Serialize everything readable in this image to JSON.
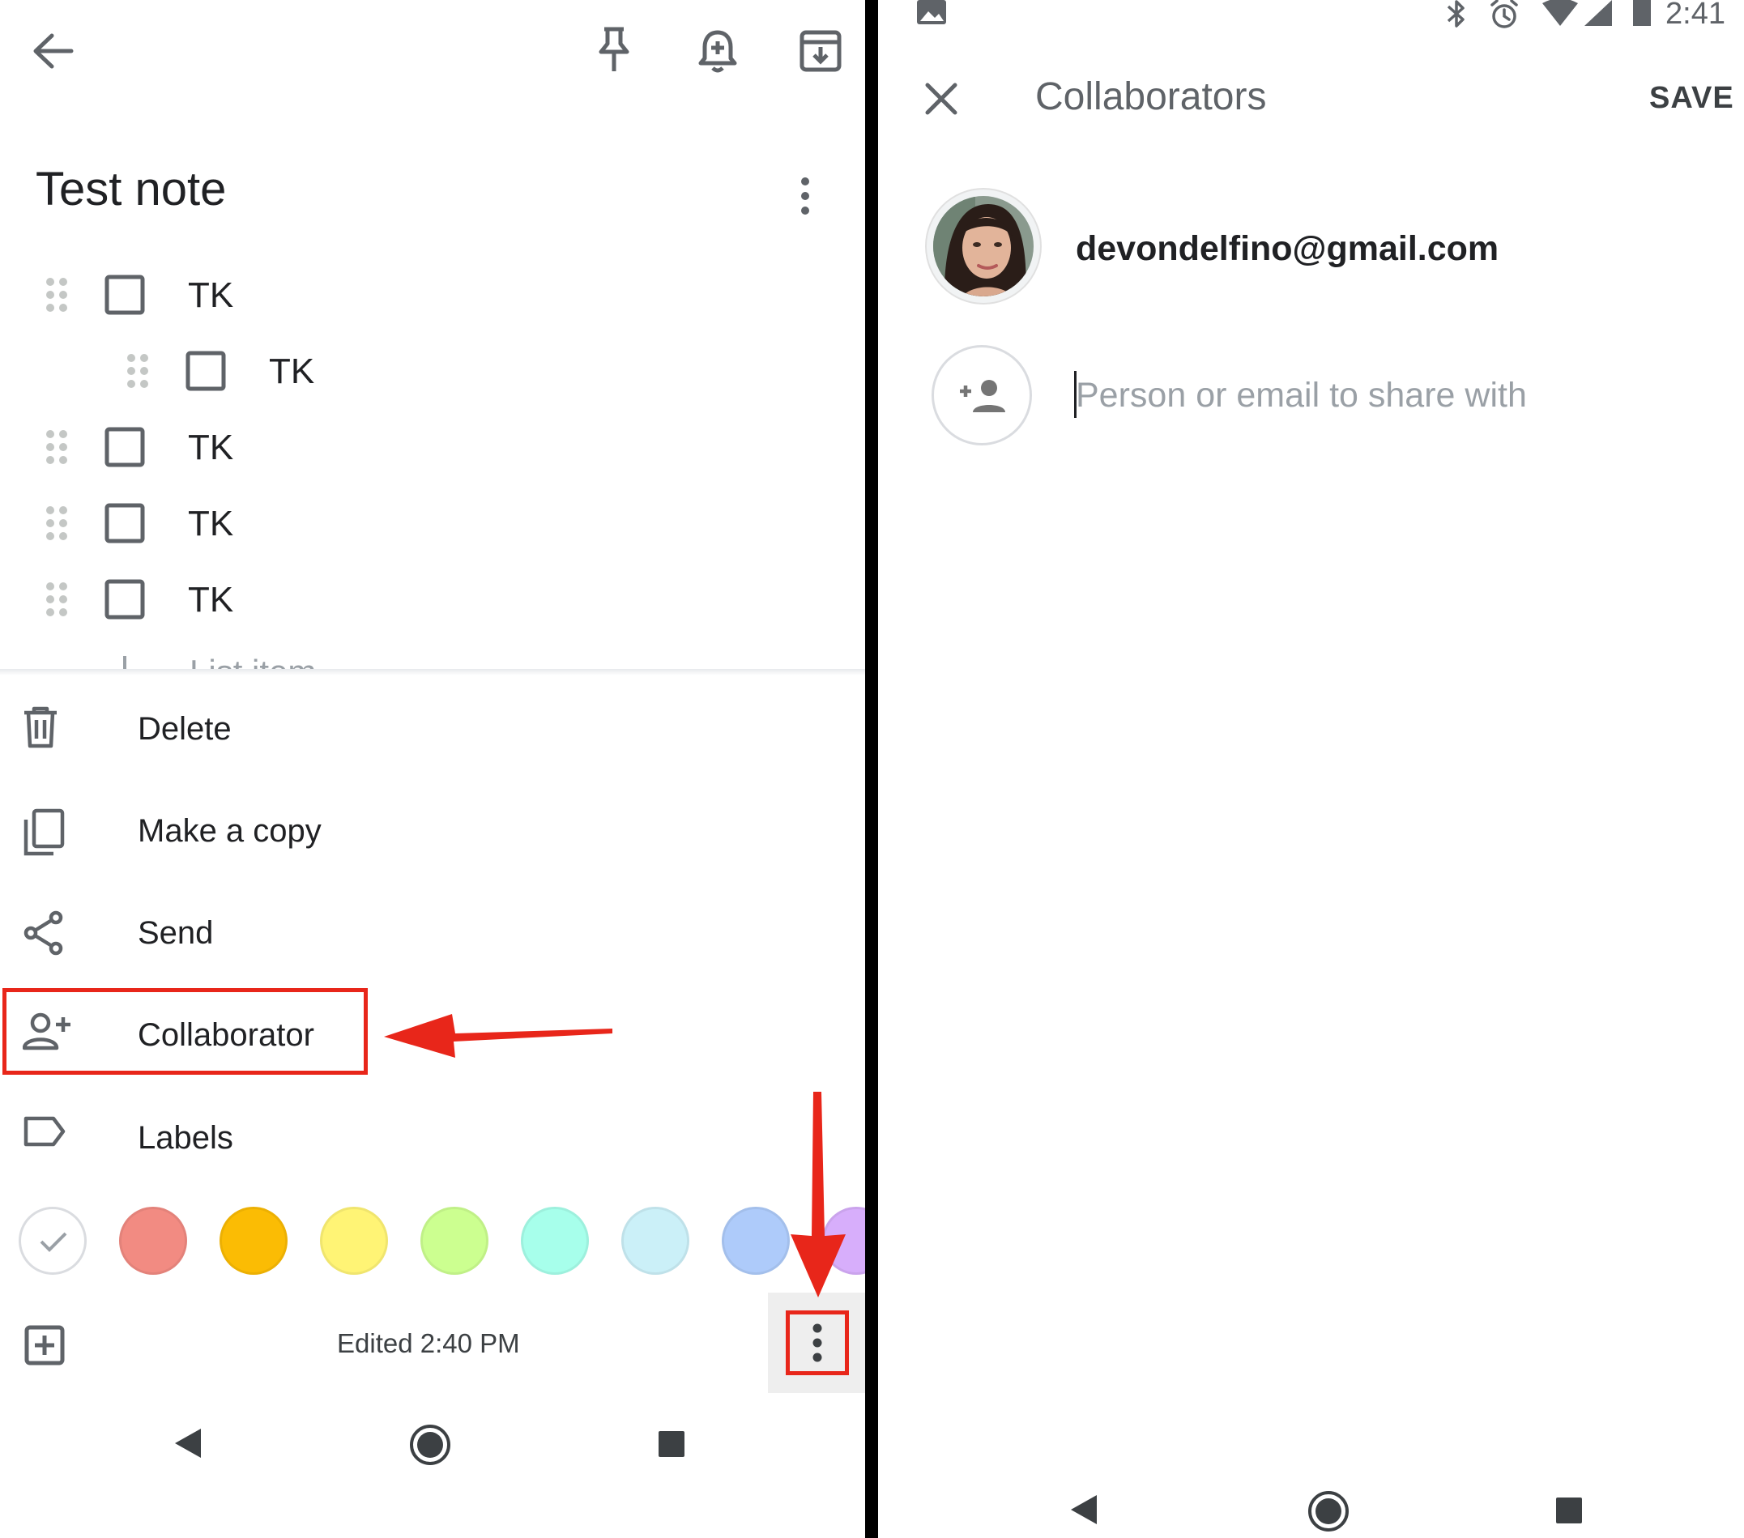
{
  "left": {
    "note_title": "Test note",
    "items": [
      {
        "label": "TK",
        "indent": false
      },
      {
        "label": "TK",
        "indent": true
      },
      {
        "label": "TK",
        "indent": false
      },
      {
        "label": "TK",
        "indent": false
      },
      {
        "label": "TK",
        "indent": false
      }
    ],
    "add_item_placeholder": "List item",
    "menu": [
      {
        "label": "Delete",
        "icon": "trash-icon"
      },
      {
        "label": "Make a copy",
        "icon": "copy-icon"
      },
      {
        "label": "Send",
        "icon": "share-icon"
      },
      {
        "label": "Collaborator",
        "icon": "add-person-icon"
      },
      {
        "label": "Labels",
        "icon": "label-icon"
      }
    ],
    "colors": [
      "#ffffff",
      "#f28b82",
      "#fbbc04",
      "#fff475",
      "#ccff90",
      "#a7ffeb",
      "#cbf0f8",
      "#aecbfa",
      "#d7aefb"
    ],
    "edited_text": "Edited 2:40 PM",
    "annotation_color": "#e8261a"
  },
  "right": {
    "status_time": "2:41",
    "title": "Collaborators",
    "save_label": "SAVE",
    "collaborator_email": "devondelfino@gmail.com",
    "share_placeholder": "Person or email to share with"
  }
}
